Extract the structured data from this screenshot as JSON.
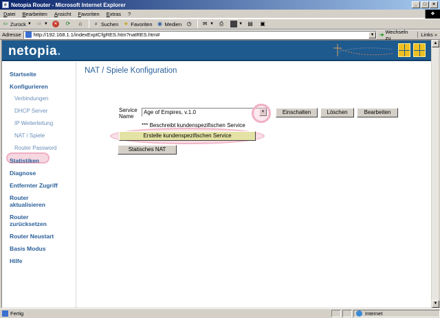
{
  "window": {
    "title": "Netopia Router - Microsoft Internet Explorer",
    "buttons": [
      "_",
      "□",
      "×"
    ]
  },
  "menu": [
    "Datei",
    "Bearbeiten",
    "Ansicht",
    "Favoriten",
    "Extras",
    "?"
  ],
  "toolbar": {
    "back": "Zurück",
    "search": "Suchen",
    "favorites": "Favoriten",
    "media": "Medien"
  },
  "address": {
    "label": "Adresse",
    "url": "http://192.168.1.1/indexExptCfgRES.htm?natRES.htm#",
    "go": "Wechseln zu",
    "links": "Links"
  },
  "header": {
    "logo": "netopia",
    "logo_dot": "."
  },
  "sidebar": {
    "items": [
      {
        "label": "Startseite"
      },
      {
        "label": "Konfigurieren"
      },
      {
        "label": "Verbindungen"
      },
      {
        "label": "DHCP Server"
      },
      {
        "label": "IP Weiterleitung"
      },
      {
        "label": "NAT / Spiele"
      },
      {
        "label": "Router Password"
      },
      {
        "label": "Statistiken"
      },
      {
        "label": "Diagnose"
      },
      {
        "label": "Entfernter Zugriff"
      },
      {
        "label1": "Router",
        "label2": "aktualisieren"
      },
      {
        "label1": "Router",
        "label2": "zurücksetzen"
      },
      {
        "label": "Router Neustart"
      },
      {
        "label": "Basis Modus"
      },
      {
        "label": "Hilfe"
      }
    ]
  },
  "main": {
    "title": "NAT / Spiele Konfiguration",
    "service_label_1": "Service",
    "service_label_2": "Name",
    "service_value": "Age of Empires, v.1.0",
    "buttons": {
      "enable": "Einschalten",
      "delete": "Löschen",
      "edit": "Bearbeiten"
    },
    "note": "*** Beschreibt kundenspezifischen Service",
    "create_button": "Erstelle kundenspezifischen Service",
    "static_nat_button": "Statisches NAT"
  },
  "status": {
    "text": "Fertig",
    "zone": "Internet"
  },
  "colors": {
    "header": "#1e5a8e",
    "nav": "#2a5f9a",
    "sub_nav": "#6a8fba",
    "highlight": "#f0b0c4"
  }
}
